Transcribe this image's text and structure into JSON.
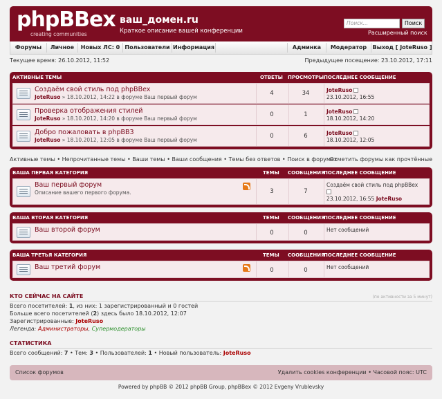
{
  "header": {
    "logo_text": "phpBBex",
    "logo_sub": "creating communities",
    "site_title": "ваш_домен.ru",
    "site_desc": "Краткое описание вашей конференции",
    "search_placeholder": "Поиск...",
    "search_button": "Поиск",
    "advanced_search": "Расширенный поиск"
  },
  "nav": {
    "forums": "Форумы",
    "personal": "Личное",
    "new_pm": "Новых ЛС: 0",
    "users": "Пользователи",
    "info": "Информация",
    "admin": "Админка",
    "moderator": "Модератор",
    "logout": "Выход [ JoteRuso ]"
  },
  "current_time": "Текущее время: 26.10.2012, 11:52",
  "last_visit": "Предыдущее посещение: 23.10.2012, 17:11",
  "active_topics": {
    "heading": "АКТИВНЫЕ ТЕМЫ",
    "col_replies": "ОТВЕТЫ",
    "col_views": "ПРОСМОТРЫ",
    "col_last": "ПОСЛЕДНЕЕ СООБЩЕНИЕ",
    "rows": [
      {
        "title": "Создаём свой стиль под phpBBex",
        "author": "JoteRuso",
        "meta": " » 18.10.2012, 14:22 в форуме Ваш первый форум",
        "replies": "4",
        "views": "34",
        "last_author": "JoteRuso",
        "last_time": "23.10.2012, 16:55"
      },
      {
        "title": "Проверка отображения стилей",
        "author": "JoteRuso",
        "meta": " » 18.10.2012, 14:20 в форуме Ваш первый форум",
        "replies": "0",
        "views": "1",
        "last_author": "JoteRuso",
        "last_time": "18.10.2012, 14:20"
      },
      {
        "title": "Добро пожаловать в phpBB3",
        "author": "JoteRuso",
        "meta": " » 18.10.2012, 12:05 в форуме Ваш первый форум",
        "replies": "0",
        "views": "6",
        "last_author": "JoteRuso",
        "last_time": "18.10.2012, 12:05"
      }
    ]
  },
  "quick_links": {
    "active": "Активные темы",
    "unread": "Непрочитанные темы",
    "your_topics": "Ваши темы",
    "your_posts": "Ваши сообщения",
    "unanswered": "Темы без ответов",
    "search_forums": "Поиск в форумах",
    "sep": " • ",
    "mark_read": "Отметить форумы как прочтённые"
  },
  "categories": [
    {
      "name": "ВАША ПЕРВАЯ КАТЕГОРИЯ",
      "col_topics": "ТЕМЫ",
      "col_posts": "СООБЩЕНИЯ",
      "col_last": "ПОСЛЕДНЕЕ СООБЩЕНИЕ",
      "forum": {
        "title": "Ваш первый форум",
        "desc": "Описание вашего первого форума.",
        "topics": "3",
        "posts": "7",
        "last_title": "Создаём свой стиль под phpBBex",
        "last_time": "23.10.2012, 16:55",
        "last_author": "JoteRuso"
      }
    },
    {
      "name": "ВАША ВТОРАЯ КАТЕГОРИЯ",
      "col_topics": "ТЕМЫ",
      "col_posts": "СООБЩЕНИЯ",
      "col_last": "ПОСЛЕДНЕЕ СООБЩЕНИЕ",
      "forum": {
        "title": "Ваш второй форум",
        "desc": "",
        "topics": "0",
        "posts": "0",
        "last_title": "Нет сообщений"
      }
    },
    {
      "name": "ВАША ТРЕТЬЯ КАТЕГОРИЯ",
      "col_topics": "ТЕМЫ",
      "col_posts": "СООБЩЕНИЯ",
      "col_last": "ПОСЛЕДНЕЕ СООБЩЕНИЕ",
      "forum": {
        "title": "Ваш третий форум",
        "desc": "",
        "topics": "0",
        "posts": "0",
        "last_title": "Нет сообщений"
      }
    }
  ],
  "online": {
    "title": "КТО СЕЙЧАС НА САЙТЕ",
    "note": "(по активности за 5 минут)",
    "total_a": "Всего посетителей: ",
    "total_n": "1",
    "total_b": ", из них: 1 зарегистрированный и 0 гостей",
    "most_a": "Больше всего посетителей (",
    "most_n": "2",
    "most_b": ") здесь было 18.10.2012, 12:07",
    "registered_label": "Зарегистрированные: ",
    "registered_user": "JoteRuso",
    "legend_label": "Легенда: ",
    "legend_admins": "Администраторы",
    "legend_comma": ", ",
    "legend_mods": "Супермодераторы"
  },
  "stats": {
    "title": "СТАТИСТИКА",
    "posts_label": "Всего сообщений: ",
    "posts": "7",
    "topics_label": " • Тем: ",
    "topics": "3",
    "users_label": " • Пользователей: ",
    "users": "1",
    "newest_label": " • Новый пользователь: ",
    "newest": "JoteRuso"
  },
  "footer": {
    "forum_list": "Список форумов",
    "delete_cookies": "Удалить cookies конференции",
    "timezone": " • Часовой пояс: UTC",
    "copyright": "Powered by phpBB © 2012 phpBB Group, phpBBex © 2012 Evgeny Vrublevsky"
  }
}
